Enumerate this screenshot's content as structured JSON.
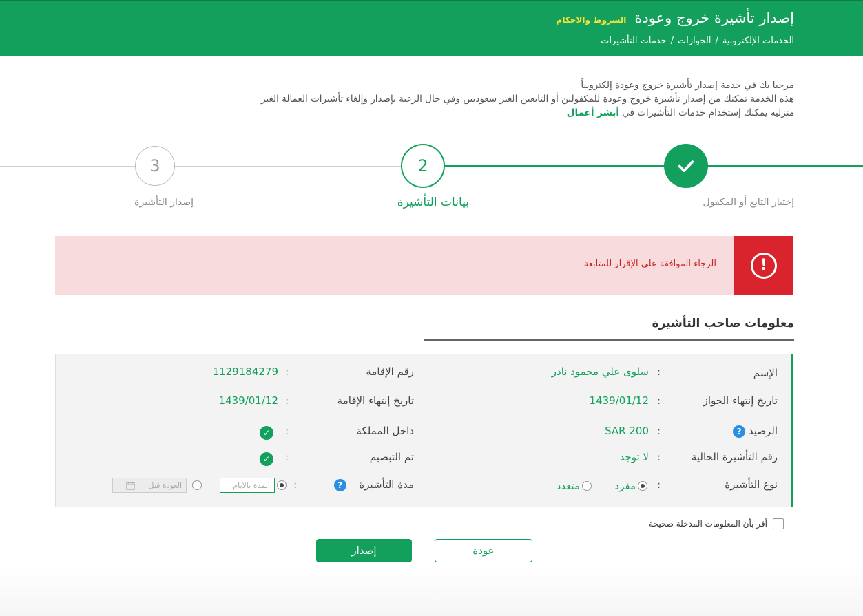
{
  "header": {
    "title": "إصدار تأشيرة خروج وعودة",
    "terms_link": "الشروط والاحكام",
    "breadcrumb": [
      "الخدمات الإلكترونية",
      "الجوازات",
      "خدمات التأشيرات"
    ],
    "breadcrumb_sep": "/"
  },
  "intro": {
    "line1": "مرحبا بك في خدمة إصدار تأشيرة خروج وعودة إلكترونياً",
    "line2": "هذه الخدمة تمكنك من إصدار تأشيرة خروج وعودة للمكفولين أو التابعين الغير سعوديين وفي حال الرغبة بإصدار وإلغاء تأشيرات العمالة الغير",
    "line3_prefix": "منزلية يمكنك إستخدام خدمات التأشيرات في",
    "line3_link": "أبشر أعمال"
  },
  "stepper": {
    "steps": [
      {
        "number": "",
        "label": "إختيار التابع أو المكفول",
        "state": "done"
      },
      {
        "number": "2",
        "label": "بيانات التأشيرة",
        "state": "active"
      },
      {
        "number": "3",
        "label": "إصدار التأشيرة",
        "state": "pending"
      }
    ]
  },
  "alert": {
    "icon": "!",
    "message": "الرجاء الموافقة على الإقرار للمتابعة"
  },
  "section": {
    "title": "معلومات صاحب التأشيرة"
  },
  "info": {
    "colon": ":",
    "name_label": "الإسم",
    "name_value": "سلوى علي محمود نادر",
    "iqama_label": "رقم الإقامة",
    "iqama_value": "1129184279",
    "passport_expiry_label": "تاريخ إنتهاء الجواز",
    "passport_expiry_value": "1439/01/12",
    "iqama_expiry_label": "تاريخ إنتهاء الإقامة",
    "iqama_expiry_value": "1439/01/12",
    "balance_label": "الرصيد",
    "balance_value": "SAR 200",
    "inside_kingdom_label": "داخل المملكة",
    "current_visa_label": "رقم التأشيرة الحالية",
    "current_visa_value": "لا توجد",
    "fingerprinted_label": "تم التبصيم",
    "visa_type_label": "نوع التأشيرة",
    "visa_type_single": "مفرد",
    "visa_type_multiple": "متعدد",
    "visa_duration_label": "مدة التأشيرة",
    "duration_days_placeholder": "المدة بالايام",
    "return_before_placeholder": "العودة قبل"
  },
  "agreement": {
    "label": "أقر بأن المعلومات المدخلة صحيحة"
  },
  "buttons": {
    "issue": "إصدار",
    "back": "عودة"
  },
  "colors": {
    "brand_green": "#12a05c",
    "alert_red": "#d9232d",
    "alert_bg": "#f8dcdd",
    "help_blue": "#2a8fe0",
    "terms_yellow": "#f5e33b"
  },
  "icons": {
    "done_step": "check-icon",
    "alert": "exclamation-circle-icon",
    "help": "question-circle-icon",
    "calendar": "calendar-icon"
  }
}
